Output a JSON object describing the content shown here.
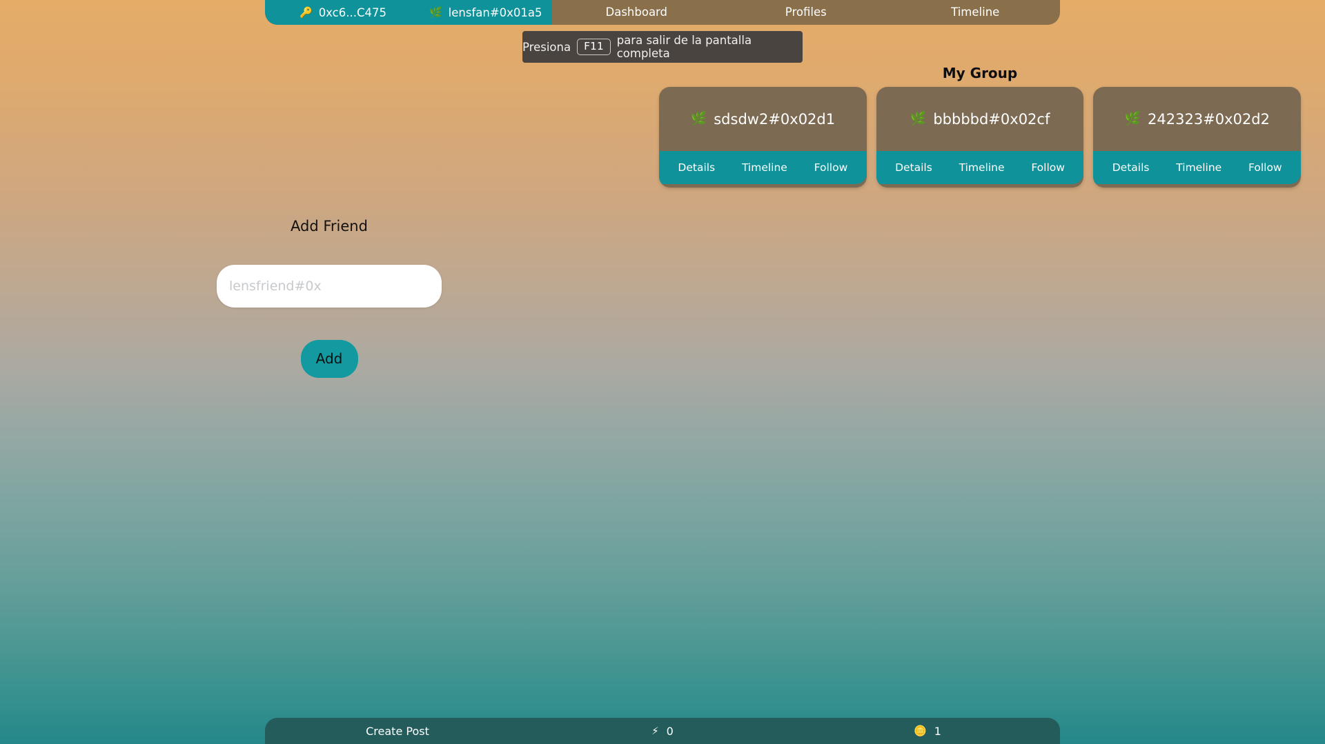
{
  "theme": {
    "bg_top": "#e5ac68",
    "bg_bottom": "#25878a",
    "accent_teal": "#0f9299",
    "nav_brown": "#8a6f4b",
    "card_brown": "#7c6a53",
    "bottombar_teal": "#245c5c",
    "tooltip_bg": "#4a4440"
  },
  "topnav": {
    "identity": {
      "wallet": {
        "icon": "key-icon",
        "glyph": "🔑",
        "label": "0xc6...C475"
      },
      "profile": {
        "icon": "herb-icon",
        "glyph": "🌿",
        "label": "lensfan#0x01a5"
      }
    },
    "tabs": [
      {
        "label": "Dashboard",
        "name": "tab-dashboard"
      },
      {
        "label": "Profiles",
        "name": "tab-profiles"
      },
      {
        "label": "Timeline",
        "name": "tab-timeline"
      }
    ]
  },
  "fullscreen_tooltip": {
    "prefix": "Presiona",
    "key": "F11",
    "suffix": "para salir de la pantalla completa"
  },
  "group": {
    "title": "My Group",
    "members": [
      {
        "icon": "herb-icon",
        "glyph": "🌿",
        "handle": "sdsdw2#0x02d1",
        "actions": [
          "Details",
          "Timeline",
          "Follow"
        ]
      },
      {
        "icon": "herb-icon",
        "glyph": "🌿",
        "handle": "bbbbbd#0x02cf",
        "actions": [
          "Details",
          "Timeline",
          "Follow"
        ]
      },
      {
        "icon": "herb-icon",
        "glyph": "🌿",
        "handle": "242323#0x02d2",
        "actions": [
          "Details",
          "Timeline",
          "Follow"
        ]
      }
    ]
  },
  "add_friend": {
    "title": "Add Friend",
    "input_value": "",
    "input_placeholder": "lensfriend#0x",
    "button_label": "Add"
  },
  "bottombar": {
    "create_post": "Create Post",
    "stats": [
      {
        "icon": "lightning-bolt-icon",
        "glyph": "⚡",
        "value": "0"
      },
      {
        "icon": "coin-icon",
        "glyph": "🪙",
        "value": "1"
      }
    ]
  }
}
